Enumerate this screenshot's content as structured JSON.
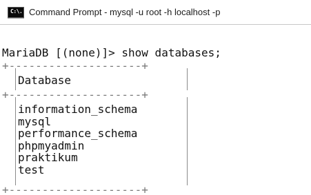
{
  "window": {
    "title": "Command Prompt - mysql  -u root -h localhost -p",
    "icon": "cmd-icon",
    "icon_text": "C:\\."
  },
  "console": {
    "prompt_line": "MariaDB [(none)]> show databases;",
    "border_top": "+--------------------+",
    "header": "Database",
    "border_mid": "+--------------------+",
    "rows": [
      "information_schema",
      "mysql",
      "performance_schema",
      "phpmyadmin",
      "praktikum",
      "test"
    ],
    "border_bottom": "+--------------------+"
  }
}
